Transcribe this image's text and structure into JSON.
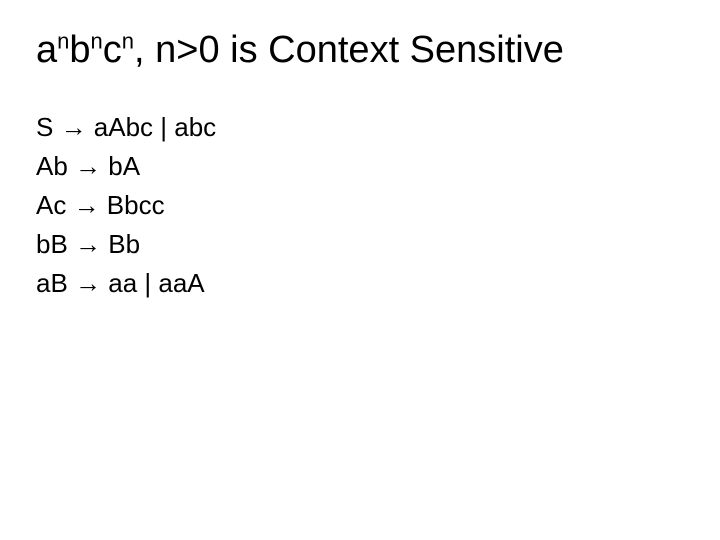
{
  "title": {
    "expr_a": "a",
    "sup_a": "n",
    "expr_b": "b",
    "sup_b": "n",
    "expr_c": "c",
    "sup_c": "n",
    "rest": ", n>0 is Context Sensitive"
  },
  "rules": [
    "S → aAbc | abc",
    "Ab → bA",
    "Ac → Bbcc",
    "bB → Bb",
    "aB → aa | aaA"
  ]
}
